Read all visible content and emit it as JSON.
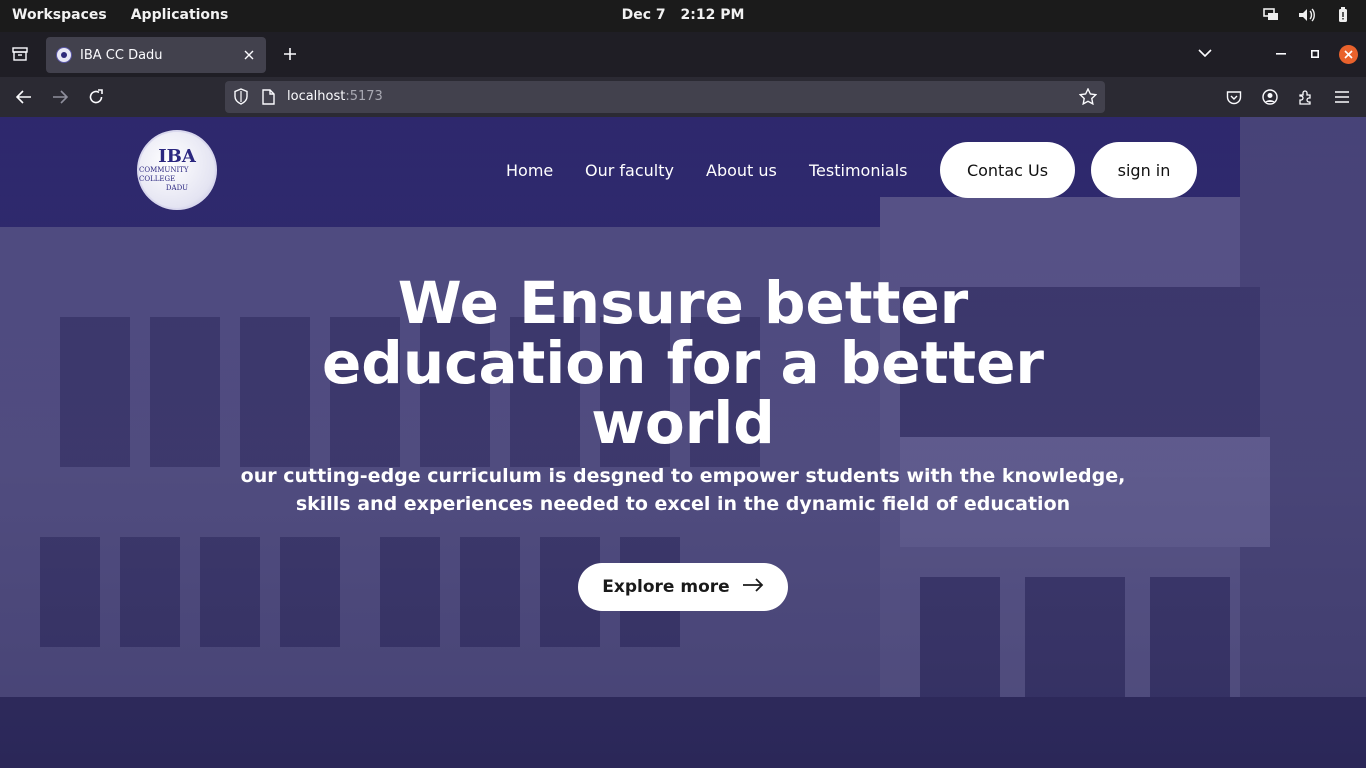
{
  "system_bar": {
    "workspaces": "Workspaces",
    "applications": "Applications",
    "date": "Dec 7",
    "time": "2:12 PM"
  },
  "browser": {
    "tab": {
      "title": "IBA CC Dadu"
    },
    "url": {
      "host": "localhost",
      "port": ":5173"
    }
  },
  "site": {
    "logo": {
      "line1": "IBA",
      "line2": "COMMUNITY COLLEGE",
      "line3": "DADU"
    },
    "nav": {
      "home": "Home",
      "faculty": "Our faculty",
      "about": "About us",
      "testimonials": "Testimonials",
      "contact": "Contac Us",
      "signin": "sign in"
    },
    "hero": {
      "title": "We Ensure better education for a better world",
      "subtitle": "our cutting-edge curriculum is desgned to empower students with the knowledge, skills and experiences needed to excel in the dynamic field of education",
      "cta": "Explore more"
    }
  },
  "colors": {
    "overlay": "#261f6e",
    "button_bg": "#ffffff",
    "close_button": "#e9622c"
  }
}
